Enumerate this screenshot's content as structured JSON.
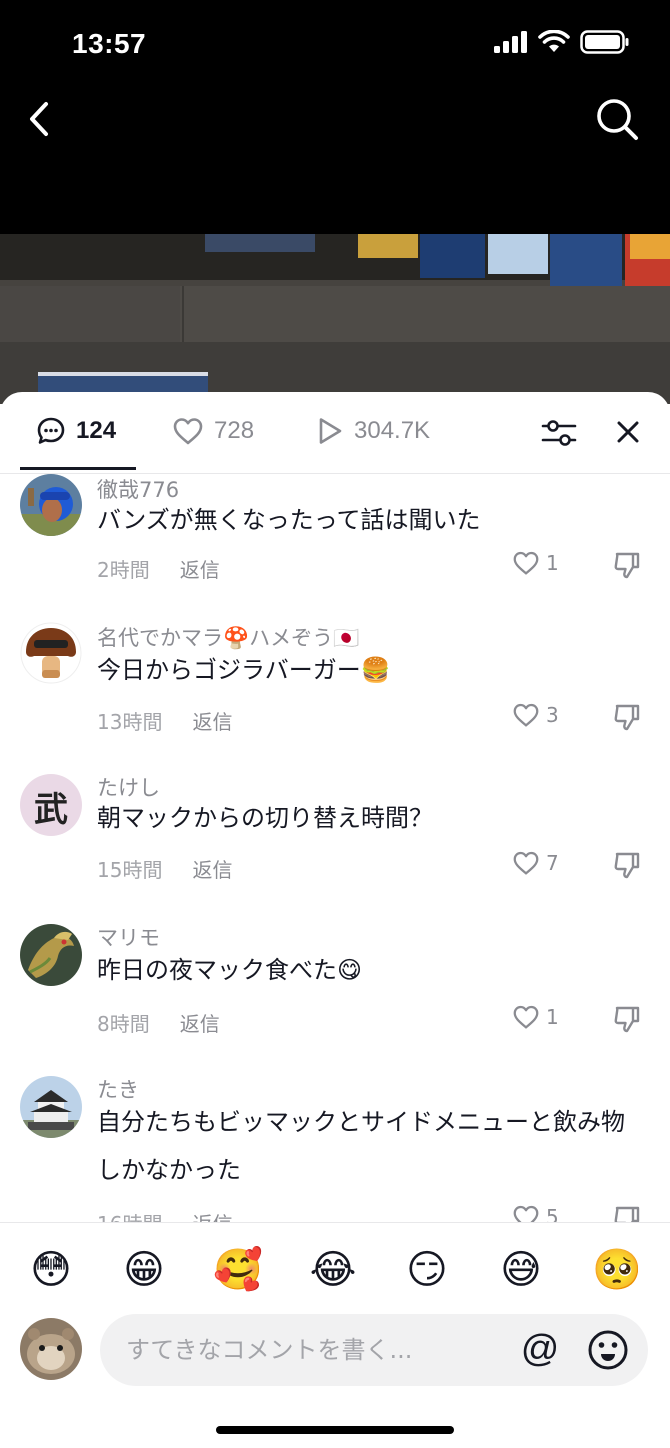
{
  "status_bar": {
    "time": "13:57"
  },
  "nav": {
    "back_icon": "chevron-left-icon",
    "search_icon": "search-icon"
  },
  "tabs": {
    "comments_count": "124",
    "likes_count": "728",
    "views_count": "304.7K"
  },
  "comments": [
    {
      "user": "徹哉776",
      "text": "バンズが無くなったって話は聞いた",
      "time": "2時間",
      "reply": "返信",
      "likes": "1"
    },
    {
      "user": "名代でかマラ🍄ハメぞう🇯🇵",
      "text": "今日からゴジラバーガー🍔",
      "time": "13時間",
      "reply": "返信",
      "likes": "3"
    },
    {
      "user": "たけし",
      "text": "朝マックからの切り替え時間？",
      "time": "15時間",
      "reply": "返信",
      "likes": "7"
    },
    {
      "user": "マリモ",
      "text": "昨日の夜マック食べた😋",
      "time": "8時間",
      "reply": "返信",
      "likes": "1"
    },
    {
      "user": "たき",
      "text": "自分たちもビッマックとサイドメニューと飲み物しかなかった",
      "time": "16時間",
      "reply": "返信",
      "likes": "5"
    }
  ],
  "avatar_glyphs": {
    "takeshi": "武"
  },
  "emoji_bar": [
    "😳",
    "😁",
    "🥰",
    "😂",
    "😏",
    "😅",
    "🥺"
  ],
  "input": {
    "placeholder": "すてきなコメントを書く...",
    "at_label": "@"
  },
  "colors": {
    "text": "#161823",
    "secondary": "#8a8b91",
    "input_bg": "#f1f1f2"
  }
}
